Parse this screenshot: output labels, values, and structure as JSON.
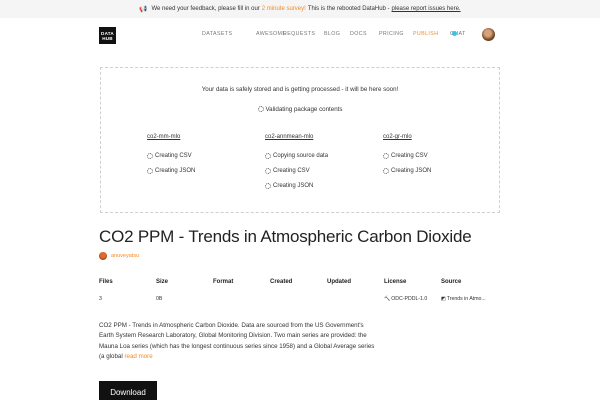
{
  "banner": {
    "icon": "megaphone-icon",
    "part1": "We need your feedback, please fill in our",
    "survey_link": "2 minute survey!",
    "part2": "This is the rebooted DataHub -",
    "issues_link": "please report issues here."
  },
  "logo": {
    "line1": "DATA",
    "line2": "HUB"
  },
  "nav": {
    "datasets": "DATASETS",
    "awesome": "AWESOME",
    "requests": "REQUESTS",
    "blog": "BLOG",
    "docs": "DOCS",
    "pricing": "PRICING",
    "publish": "PUBLISH",
    "chat": "CHAT"
  },
  "status": {
    "message": "Your data is safely stored and is getting processed - it will be here soon!",
    "validating": "Validating package contents",
    "columns": [
      {
        "name": "co2-mm-mlo",
        "items": [
          "Creating CSV",
          "Creating JSON"
        ]
      },
      {
        "name": "co2-annmean-mlo",
        "items": [
          "Copying source data",
          "Creating CSV",
          "Creating JSON"
        ]
      },
      {
        "name": "co2-gr-mlo",
        "items": [
          "Creating CSV",
          "Creating JSON"
        ]
      }
    ]
  },
  "dataset": {
    "title": "CO2 PPM - Trends in Atmospheric Carbon Dioxide",
    "author": "anuveyatsu",
    "table": {
      "headers": [
        "Files",
        "Size",
        "Format",
        "Created",
        "Updated",
        "License",
        "Source"
      ],
      "values": [
        "3",
        "0B",
        "",
        "",
        "",
        "ODC-PDDL-1.0",
        "Trends in Atmo..."
      ]
    },
    "description": "CO2 PPM - Trends in Atmospheric Carbon Dioxide. Data are sourced from the US Government's Earth System Research Laboratory, Global Monitoring Division. Two main series are provided: the Mauna Loa series (which has the longest continuous series since 1958) and a Global Average series (a global",
    "read_more": "read more",
    "download": "Download"
  },
  "colors": {
    "accent": "#f08c2a",
    "chat_dot": "#3cc1e6",
    "button": "#111111"
  }
}
